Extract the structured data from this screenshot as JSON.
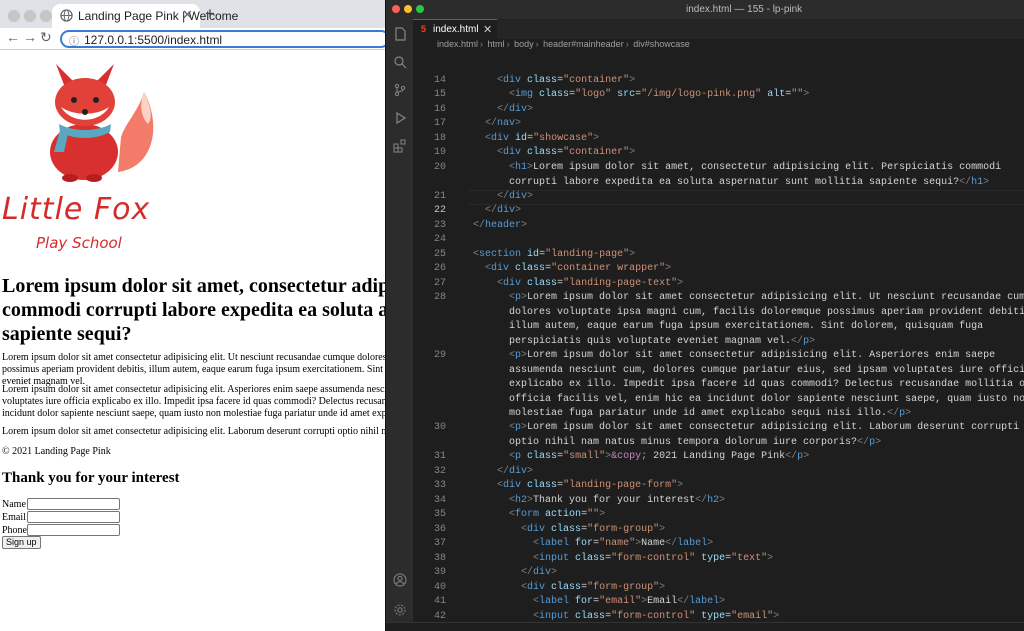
{
  "browser": {
    "tab_title": "Landing Page Pink | Welcome",
    "url": "127.0.0.1:5500/index.html",
    "page": {
      "brand_name": "Little Fox",
      "brand_tagline": "Play School",
      "heading": "Lorem ipsum dolor sit amet, consectetur adipisicing elit. Perspiciatis commodi corrupti labore expedita ea soluta aspernatur sunt mollitia sapiente sequi?",
      "paragraphs": [
        "Lorem ipsum dolor sit amet consectetur adipisicing elit. Ut nesciunt recusandae cumque dolores voluptate ipsa magni cum, facilis doloremque possimus aperiam provident debitis, illum autem, eaque earum fuga ipsum exercitationem. Sint dolorem, quisquam fuga perspiciatis quis voluptate eveniet magnam vel.",
        "Lorem ipsum dolor sit amet consectetur adipisicing elit. Asperiores enim saepe assumenda nesciunt cum, dolores cumque pariatur eius, sed ipsam voluptates iure officia explicabo ex illo. Impedit ipsa facere id quas commodi? Delectus recusandae mollitia odit officia facilis vel, enim hic ea incidunt dolor sapiente nesciunt saepe, quam iusto non molestiae fuga pariatur unde id amet explicabo sequi nisi illo.",
        "Lorem ipsum dolor sit amet consectetur adipisicing elit. Laborum deserunt corrupti optio nihil nam natus minus tempora dolorum iure corporis?"
      ],
      "copyright": "© 2021 Landing Page Pink",
      "form_title": "Thank you for your interest",
      "labels": {
        "name": "Name",
        "email": "Email",
        "phone": "Phone"
      },
      "submit": "Sign up"
    }
  },
  "editor": {
    "window_title": "index.html — 155 - lp-pink",
    "tab_name": "index.html",
    "breadcrumbs": [
      "index.html",
      "html",
      "body",
      "header#mainheader",
      "div#showcase"
    ]
  },
  "colors": {
    "brand_red": "#d62b2b",
    "accent_blue": "#1e6fcf",
    "editor_bg": "#1e1e1e"
  }
}
